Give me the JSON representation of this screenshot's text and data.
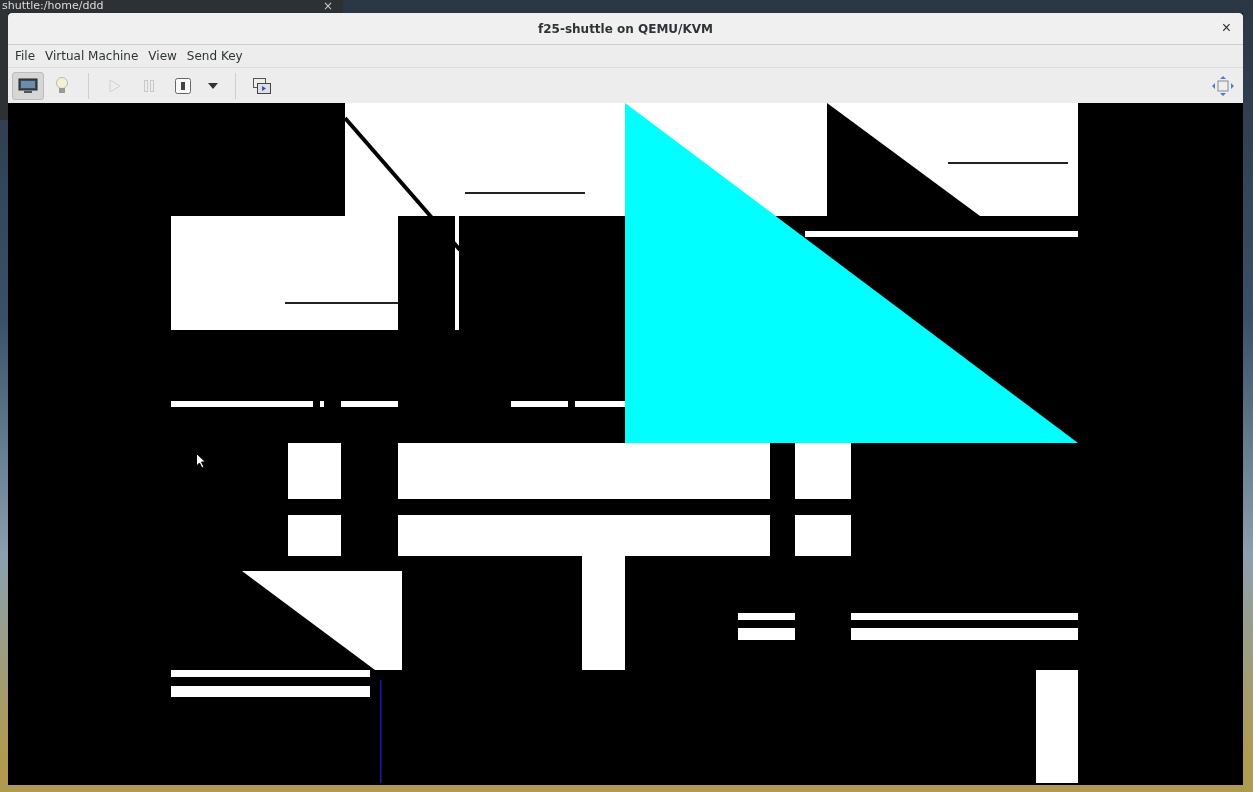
{
  "background_window": {
    "title": "shuttle:/home/ddd",
    "close": "×"
  },
  "window": {
    "title": "f25-shuttle on QEMU/KVM",
    "close": "×"
  },
  "menu": [
    {
      "label": "File"
    },
    {
      "label": "Virtual Machine"
    },
    {
      "label": "View"
    },
    {
      "label": "Send Key"
    }
  ],
  "toolbar": [
    {
      "kind": "console",
      "selected": true,
      "disabled": false
    },
    {
      "kind": "details",
      "selected": false,
      "disabled": false
    },
    {
      "kind": "separator"
    },
    {
      "kind": "run",
      "selected": false,
      "disabled": true
    },
    {
      "kind": "pause",
      "selected": false,
      "disabled": true
    },
    {
      "kind": "shutdown",
      "selected": false,
      "disabled": false
    },
    {
      "kind": "dropdown",
      "selected": false,
      "disabled": false
    },
    {
      "kind": "separator"
    },
    {
      "kind": "snapshots",
      "selected": false,
      "disabled": false
    },
    {
      "kind": "spacer"
    },
    {
      "kind": "fullscreen",
      "selected": false,
      "disabled": false
    }
  ]
}
